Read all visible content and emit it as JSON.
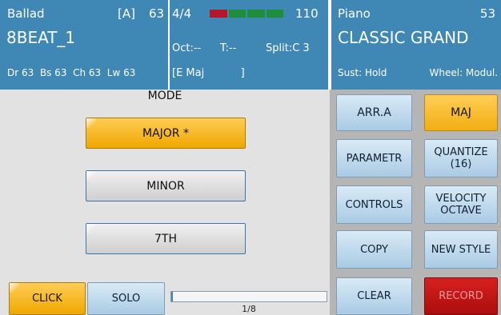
{
  "colors": {
    "header_blue": "#3f87b5",
    "accent_orange": "#f5b21e",
    "record_red": "#c01616",
    "side_blue": "#b7d4ea"
  },
  "style_panel": {
    "category": "Ballad",
    "variation": "[A]",
    "tempo_value": "63",
    "style_name": "8BEAT_1",
    "volumes": "Dr 63  Bs 63  Ch 63  Lw 63"
  },
  "status_panel": {
    "time_sig": "4/4",
    "tempo": "110",
    "octave": "Oct:--",
    "transpose": "T:--",
    "split": "Split:C 3",
    "chord": "[E Maj           ]",
    "beat_indicator": {
      "total": 4,
      "active_index": 0
    }
  },
  "voice_panel": {
    "category": "Piano",
    "number": "53",
    "voice_name": "CLASSIC GRAND",
    "sustain": "Sust: Hold",
    "wheel": "Wheel: Modul."
  },
  "mode": {
    "title": "MODE",
    "buttons": [
      {
        "label": "MAJOR *",
        "selected": true
      },
      {
        "label": "MINOR",
        "selected": false
      },
      {
        "label": "7TH",
        "selected": false
      }
    ]
  },
  "bottom_bar": {
    "click_label": "CLICK",
    "solo_label": "SOLO",
    "progress_text": "1/8",
    "progress_fraction": 0.0
  },
  "side_buttons": [
    {
      "label": "ARR.A",
      "variant": "blue"
    },
    {
      "label": "MAJ",
      "variant": "orange"
    },
    {
      "label": "PARAMETR",
      "variant": "blue"
    },
    {
      "label": "QUANTIZE\n(16)",
      "variant": "blue"
    },
    {
      "label": "CONTROLS",
      "variant": "blue"
    },
    {
      "label": "VELOCITY\nOCTAVE",
      "variant": "blue"
    },
    {
      "label": "COPY",
      "variant": "blue"
    },
    {
      "label": "NEW STYLE",
      "variant": "blue"
    },
    {
      "label": "CLEAR",
      "variant": "blue"
    },
    {
      "label": "RECORD",
      "variant": "red"
    }
  ]
}
